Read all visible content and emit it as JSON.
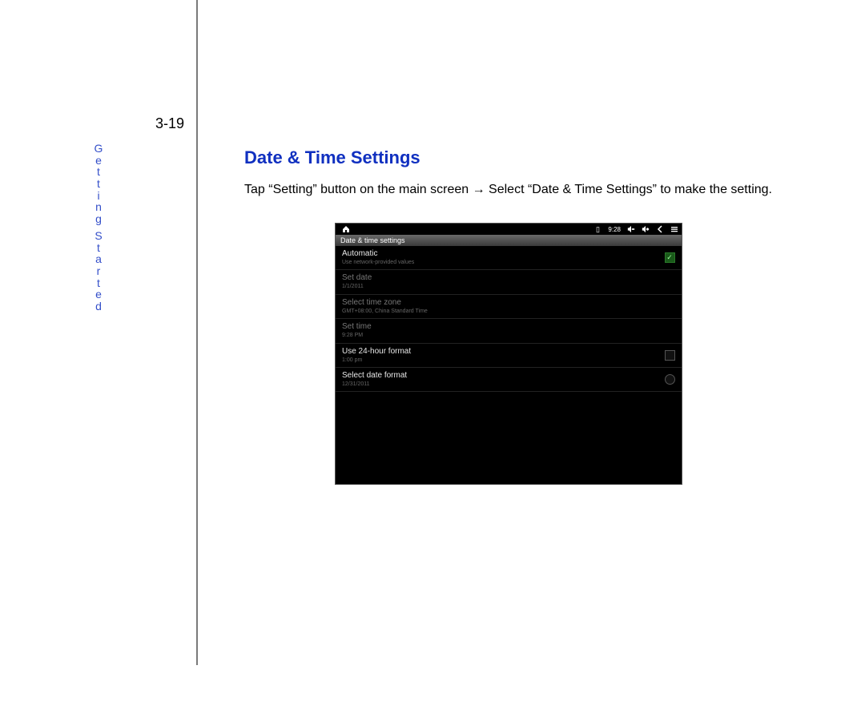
{
  "page_number": "3-19",
  "section_label": "Getting Started",
  "heading": "Date & Time Settings",
  "body": "Tap “Setting” button on the main screen → Select “Date & Time Settings” to make the setting.",
  "screenshot": {
    "statusbar": {
      "home_icon": "home-icon",
      "indicator": "▯",
      "clock": "9:28",
      "vol_down": "🔈−",
      "vol_up": "🔈+",
      "back": "‹",
      "menu": "☰"
    },
    "titlebar": "Date & time settings",
    "rows": [
      {
        "title": "Automatic",
        "subtitle": "Use network-provided values",
        "dim": false,
        "control": "checkbox-on"
      },
      {
        "title": "Set date",
        "subtitle": "1/1/2011",
        "dim": true,
        "control": "none"
      },
      {
        "title": "Select time zone",
        "subtitle": "GMT+08:00, China Standard Time",
        "dim": true,
        "control": "none"
      },
      {
        "title": "Set time",
        "subtitle": "9:28 PM",
        "dim": true,
        "control": "none"
      },
      {
        "title": "Use 24-hour format",
        "subtitle": "1:00 pm",
        "dim": false,
        "control": "checkbox-off"
      },
      {
        "title": "Select date format",
        "subtitle": "12/31/2011",
        "dim": false,
        "control": "radio"
      }
    ]
  }
}
